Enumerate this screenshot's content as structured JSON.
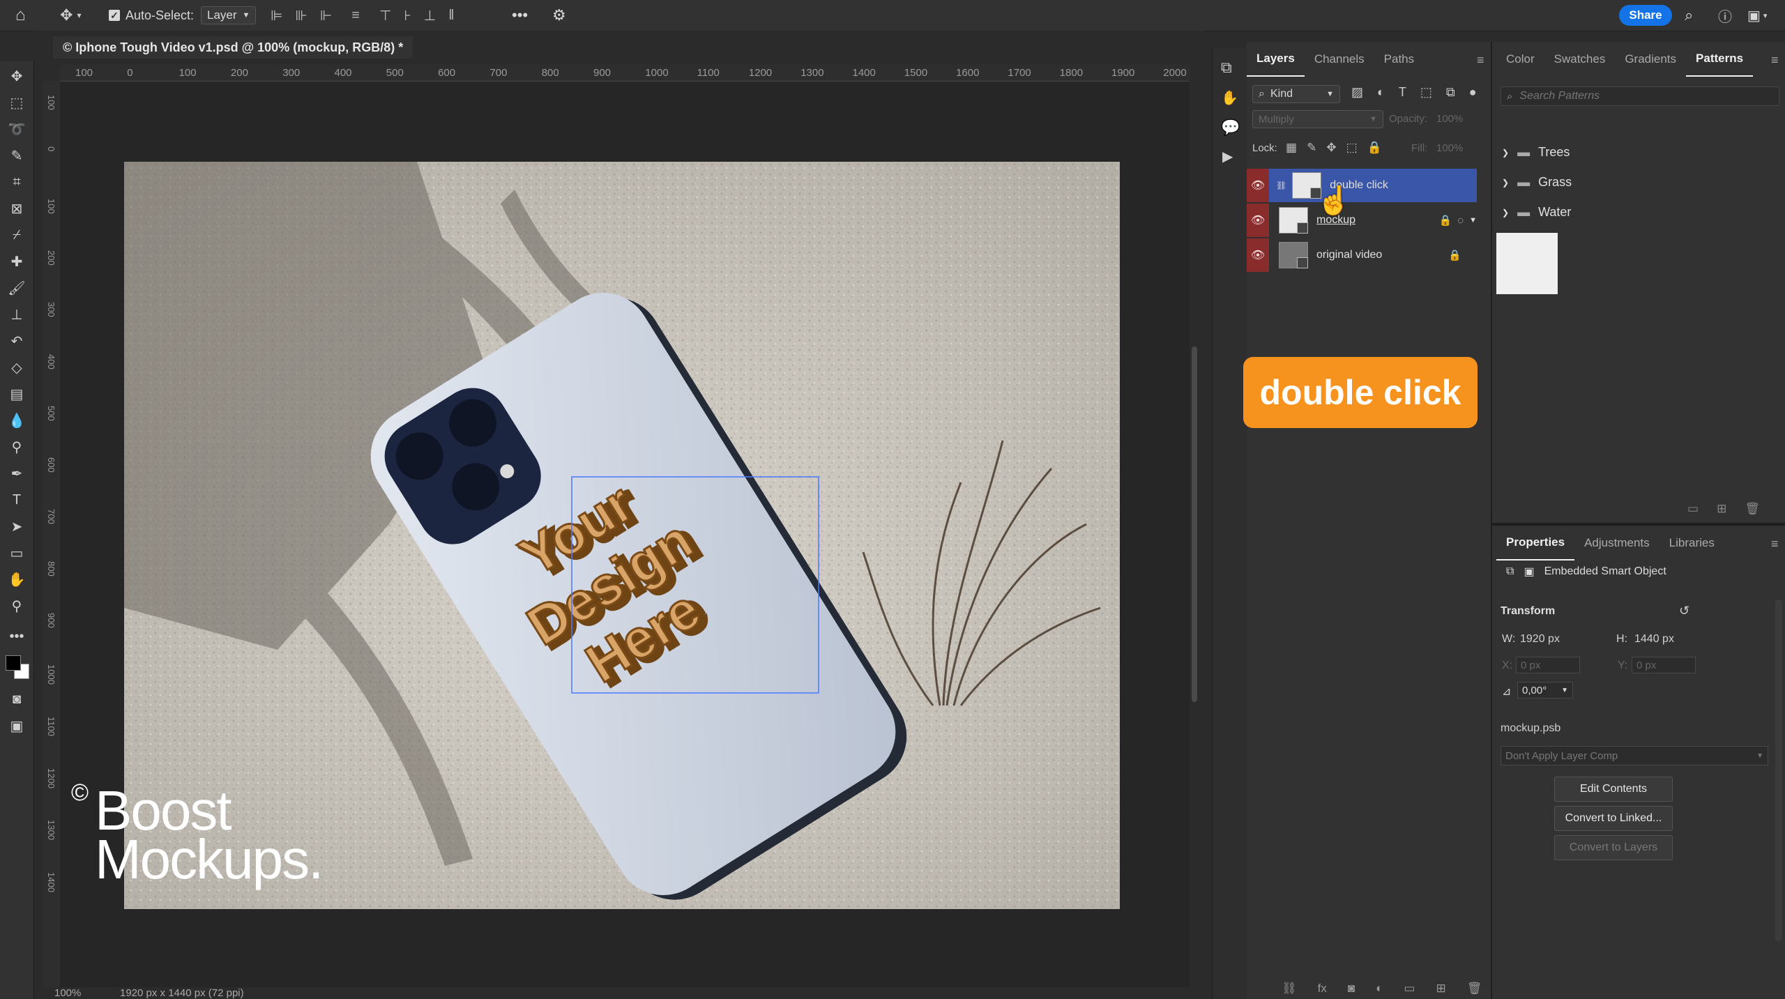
{
  "options_bar": {
    "auto_select_label": "Auto-Select:",
    "auto_select_value": "Layer",
    "share_label": "Share"
  },
  "document": {
    "tab_title": "© Iphone Tough Video v1.psd @ 100% (mockup, RGB/8) *"
  },
  "ruler": {
    "h_ticks": [
      "100",
      "0",
      "100",
      "200",
      "300",
      "400",
      "500",
      "600",
      "700",
      "800",
      "900",
      "1000",
      "1100",
      "1200",
      "1300",
      "1400",
      "1500",
      "1600",
      "1700",
      "1800",
      "1900",
      "2000"
    ],
    "v_ticks": [
      "100",
      "0",
      "100",
      "200",
      "300",
      "400",
      "500",
      "600",
      "700",
      "800",
      "900",
      "1000",
      "1100",
      "1200",
      "1300",
      "1400"
    ]
  },
  "canvas": {
    "design_text": [
      "Your",
      "Design",
      "Here"
    ],
    "watermark_copyright": "©",
    "watermark_line1": "Boost",
    "watermark_line2": "Mockups."
  },
  "status": {
    "zoom": "100%",
    "doc_size": "1920 px x 1440 px (72 ppi)"
  },
  "layers_panel": {
    "tabs": [
      "Layers",
      "Channels",
      "Paths"
    ],
    "active_tab": "Layers",
    "filter_kind": "Kind",
    "blend_mode": "Multiply",
    "opacity_label": "Opacity:",
    "opacity_value": "100%",
    "lock_label": "Lock:",
    "fill_label": "Fill:",
    "fill_value": "100%",
    "layers": [
      {
        "name": "double click",
        "selected": true
      },
      {
        "name": "mockup",
        "selected": false
      },
      {
        "name": "original video",
        "selected": false
      }
    ]
  },
  "callout": {
    "text": "double click"
  },
  "patterns_panel": {
    "tabs": [
      "Color",
      "Swatches",
      "Gradients",
      "Patterns"
    ],
    "active_tab": "Patterns",
    "search_placeholder": "Search Patterns",
    "groups": [
      "Trees",
      "Grass",
      "Water"
    ]
  },
  "properties_panel": {
    "tabs": [
      "Properties",
      "Adjustments",
      "Libraries"
    ],
    "active_tab": "Properties",
    "object_type": "Embedded Smart Object",
    "section_transform": "Transform",
    "w_label": "W:",
    "w_value": "1920 px",
    "h_label": "H:",
    "h_value": "1440 px",
    "x_label": "X:",
    "x_value": "0 px",
    "y_label": "Y:",
    "y_value": "0 px",
    "angle_value": "0,00°",
    "file_name": "mockup.psb",
    "layer_comp": "Don't Apply Layer Comp",
    "buttons": [
      "Edit Contents",
      "Convert to Linked...",
      "Convert to Layers"
    ]
  },
  "colors": {
    "accent": "#1473e6",
    "callout": "#f6921e",
    "selected_layer": "#3a56a8",
    "eye_red": "#8a2c2c"
  }
}
